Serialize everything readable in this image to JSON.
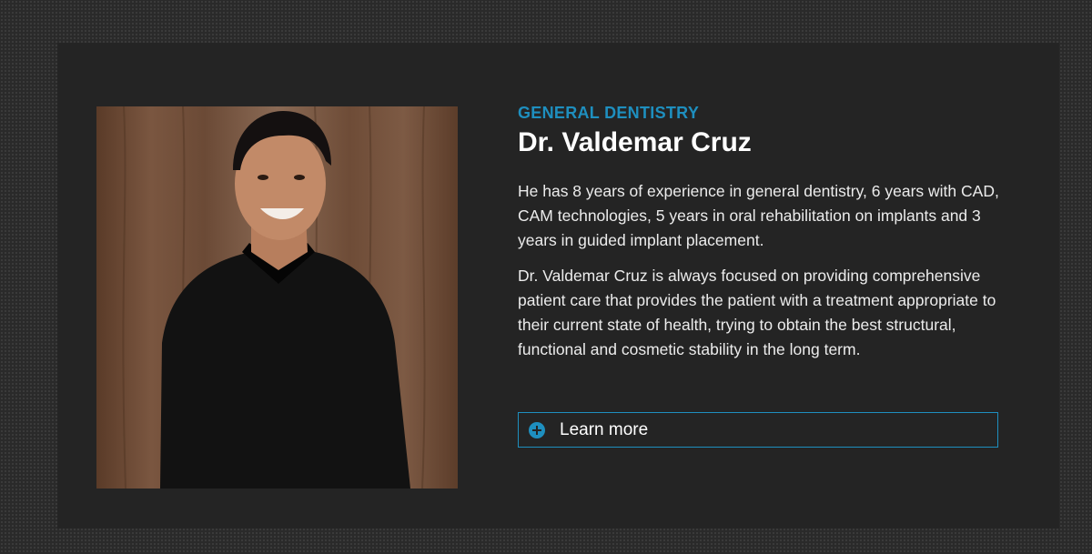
{
  "profile": {
    "specialty": "GENERAL DENTISTRY",
    "name": "Dr. Valdemar Cruz",
    "bio": [
      "He has 8 years of experience in general dentistry, 6 years with CAD, CAM technologies, 5 years in oral rehabilitation on implants and 3 years in guided implant placement.",
      "Dr. Valdemar Cruz is always focused on providing comprehensive patient care that provides the patient with a treatment appropriate to their current state of health, trying to obtain the best structural, functional and cosmetic stability in the long term."
    ],
    "learn_more_label": "Learn more",
    "learn_more_icon": "plus-circle-icon"
  },
  "colors": {
    "accent": "#1e8fbf",
    "card_background": "#242424",
    "page_background": "#2a2a2a",
    "text": "#ececec"
  }
}
